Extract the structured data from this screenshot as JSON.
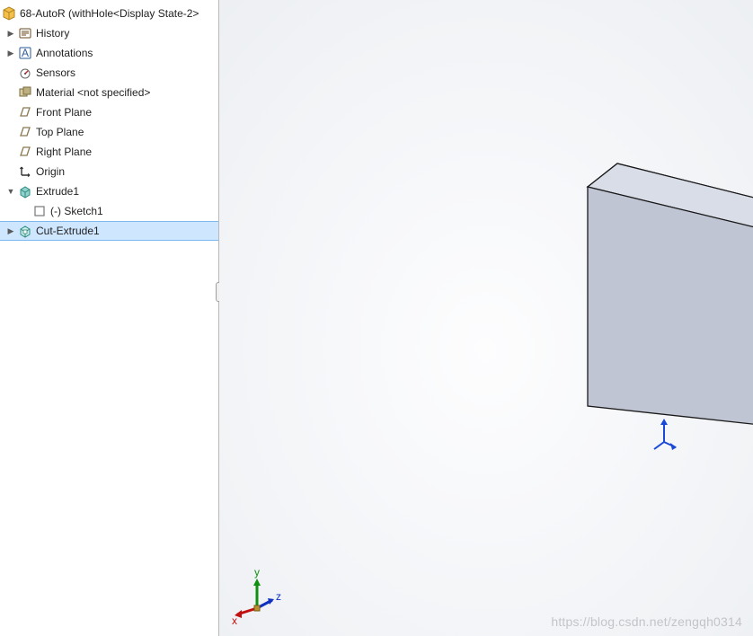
{
  "tree": {
    "root": {
      "label": "68-AutoR  (withHole<Display State-2>"
    },
    "history": {
      "label": "History"
    },
    "annotations": {
      "label": "Annotations"
    },
    "sensors": {
      "label": "Sensors"
    },
    "material": {
      "label": "Material <not specified>"
    },
    "frontPlane": {
      "label": "Front Plane"
    },
    "topPlane": {
      "label": "Top Plane"
    },
    "rightPlane": {
      "label": "Right Plane"
    },
    "origin": {
      "label": "Origin"
    },
    "extrude1": {
      "label": "Extrude1"
    },
    "sketch1": {
      "label": "(-) Sketch1"
    },
    "cutExtrude1": {
      "label": "Cut-Extrude1"
    }
  },
  "triad": {
    "x": "x",
    "y": "y",
    "z": "z"
  },
  "watermark": "https://blog.csdn.net/zengqh0314",
  "colors": {
    "part": "#f2b33a",
    "extrude": "#3fa7a0",
    "plane": "#7a6d52",
    "selection": "#cfe6ff"
  }
}
